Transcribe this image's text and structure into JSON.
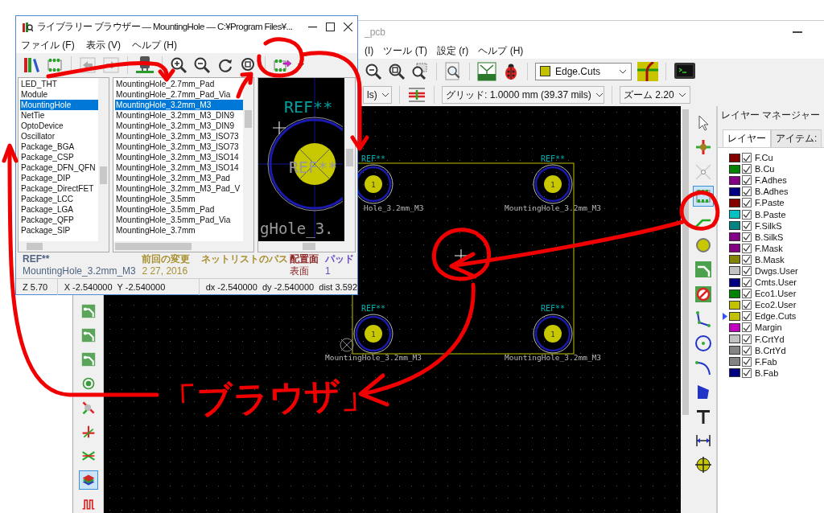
{
  "main_window": {
    "title_fragment": "_pcb",
    "menu": [
      "(I)",
      "ツール (T)",
      "設定 (r)",
      "ヘルプ (H)"
    ],
    "layer_select": "Edge.Cuts",
    "unit_fragment": "ls)",
    "grid": "グリッド: 1.0000 mm (39.37 mils)",
    "zoom": "ズーム 2.20",
    "left_tools": [
      {
        "kind": "bend",
        "selected": false
      },
      {
        "kind": "bend",
        "selected": false
      },
      {
        "kind": "bend",
        "selected": false
      },
      {
        "kind": "ring",
        "selected": false
      },
      {
        "kind": "probe",
        "selected": false
      },
      {
        "kind": "cross",
        "selected": false
      },
      {
        "kind": "crossing",
        "selected": false
      },
      {
        "kind": "layers",
        "selected": true
      },
      {
        "kind": "meander",
        "selected": false
      }
    ],
    "right_tools": [
      {
        "kind": "select",
        "selected": false
      },
      {
        "kind": "highlight",
        "selected": false
      },
      {
        "kind": "ratsnest",
        "selected": false
      },
      {
        "kind": "footprint",
        "selected": true
      },
      {
        "kind": "track",
        "selected": false
      },
      {
        "kind": "via",
        "selected": false
      },
      {
        "kind": "route",
        "selected": false
      },
      {
        "kind": "keepout",
        "selected": false
      },
      {
        "kind": "line",
        "selected": false
      },
      {
        "kind": "circle",
        "selected": false
      },
      {
        "kind": "arc",
        "selected": false
      },
      {
        "kind": "polygon",
        "selected": false
      },
      {
        "kind": "text",
        "selected": false
      },
      {
        "kind": "dimension",
        "selected": false
      },
      {
        "kind": "target",
        "selected": false
      }
    ],
    "canvas": {
      "holes": [
        {
          "ref": "REF**",
          "value": "Hole_3.2mm_M3",
          "pad": "1"
        },
        {
          "ref": "REF**",
          "value": "MountingHole_3.2mm_M3",
          "pad": "1"
        },
        {
          "ref": "REF**",
          "value": "MountingHole_3.2mm_M3",
          "pad": "1"
        },
        {
          "ref": "REF**",
          "value": "MountingHole_3.2mm_M3",
          "pad": "1"
        }
      ]
    },
    "layer_manager": {
      "title": "レイヤー マネージャー",
      "tabs": [
        {
          "label": "レイヤー",
          "selected": true
        },
        {
          "label": "アイテム:",
          "selected": false
        }
      ],
      "layers": [
        {
          "name": "F.Cu",
          "color": "#840000",
          "checked": true,
          "active": false
        },
        {
          "name": "B.Cu",
          "color": "#008400",
          "checked": true,
          "active": false
        },
        {
          "name": "F.Adhes",
          "color": "#840084",
          "checked": true,
          "active": false
        },
        {
          "name": "B.Adhes",
          "color": "#000084",
          "checked": true,
          "active": false
        },
        {
          "name": "F.Paste",
          "color": "#840000",
          "checked": true,
          "active": false
        },
        {
          "name": "B.Paste",
          "color": "#00c2c2",
          "checked": true,
          "active": false
        },
        {
          "name": "F.SilkS",
          "color": "#008484",
          "checked": true,
          "active": false
        },
        {
          "name": "B.SilkS",
          "color": "#840084",
          "checked": true,
          "active": false
        },
        {
          "name": "F.Mask",
          "color": "#840084",
          "checked": true,
          "active": false
        },
        {
          "name": "B.Mask",
          "color": "#848400",
          "checked": true,
          "active": false
        },
        {
          "name": "Dwgs.User",
          "color": "#c2c2c2",
          "checked": true,
          "active": false
        },
        {
          "name": "Cmts.User",
          "color": "#000084",
          "checked": true,
          "active": false
        },
        {
          "name": "Eco1.User",
          "color": "#008400",
          "checked": true,
          "active": false
        },
        {
          "name": "Eco2.User",
          "color": "#c2c200",
          "checked": true,
          "active": false
        },
        {
          "name": "Edge.Cuts",
          "color": "#c2c200",
          "checked": true,
          "active": true
        },
        {
          "name": "Margin",
          "color": "#c200c2",
          "checked": true,
          "active": false
        },
        {
          "name": "F.CrtYd",
          "color": "#c2c2c2",
          "checked": true,
          "active": false
        },
        {
          "name": "B.CrtYd",
          "color": "#848484",
          "checked": true,
          "active": false
        },
        {
          "name": "F.Fab",
          "color": "#848484",
          "checked": true,
          "active": false
        },
        {
          "name": "B.Fab",
          "color": "#000084",
          "checked": true,
          "active": false
        }
      ]
    }
  },
  "browser": {
    "title": "ライブラリー ブラウザー — MountingHole — C:¥Program Files¥...",
    "menu": [
      "ファイル (F)",
      "表示 (V)",
      "ヘルプ (H)"
    ],
    "libraries": [
      {
        "label": "LED_THT",
        "selected": false
      },
      {
        "label": "Module",
        "selected": false
      },
      {
        "label": "MountingHole",
        "selected": true
      },
      {
        "label": "NetTie",
        "selected": false
      },
      {
        "label": "OptoDevice",
        "selected": false
      },
      {
        "label": "Oscillator",
        "selected": false
      },
      {
        "label": "Package_BGA",
        "selected": false
      },
      {
        "label": "Package_CSP",
        "selected": false
      },
      {
        "label": "Package_DFN_QFN",
        "selected": false
      },
      {
        "label": "Package_DIP",
        "selected": false
      },
      {
        "label": "Package_DirectFET",
        "selected": false
      },
      {
        "label": "Package_LCC",
        "selected": false
      },
      {
        "label": "Package_LGA",
        "selected": false
      },
      {
        "label": "Package_QFP",
        "selected": false
      },
      {
        "label": "Package_SIP",
        "selected": false
      }
    ],
    "footprints": [
      {
        "label": "MountingHole_2.7mm_Pad",
        "selected": false
      },
      {
        "label": "MountingHole_2.7mm_Pad_Via",
        "selected": false
      },
      {
        "label": "MountingHole_3.2mm_M3",
        "selected": true
      },
      {
        "label": "MountingHole_3.2mm_M3_DIN9",
        "selected": false
      },
      {
        "label": "MountingHole_3.2mm_M3_DIN9",
        "selected": false
      },
      {
        "label": "MountingHole_3.2mm_M3_ISO73",
        "selected": false
      },
      {
        "label": "MountingHole_3.2mm_M3_ISO73",
        "selected": false
      },
      {
        "label": "MountingHole_3.2mm_M3_ISO14",
        "selected": false
      },
      {
        "label": "MountingHole_3.2mm_M3_ISO14",
        "selected": false
      },
      {
        "label": "MountingHole_3.2mm_M3_Pad",
        "selected": false
      },
      {
        "label": "MountingHole_3.2mm_M3_Pad_V",
        "selected": false
      },
      {
        "label": "MountingHole_3.5mm",
        "selected": false
      },
      {
        "label": "MountingHole_3.5mm_Pad",
        "selected": false
      },
      {
        "label": "MountingHole_3.5mm_Pad_Via",
        "selected": false
      },
      {
        "label": "MountingHole_3.7mm",
        "selected": false
      }
    ],
    "preview": {
      "ref_top": "REF**",
      "ref_center": "REF**",
      "value_fragment": "gHole_3."
    },
    "info": [
      {
        "title": "REF**",
        "value": "MountingHole_3.2mm_M3",
        "color": "#4f6482"
      },
      {
        "title": "前回の変更",
        "value": "2 27, 2016",
        "color": "#a89030"
      },
      {
        "title": "ネットリストのパス",
        "color": "#a89030"
      },
      {
        "title": "配置面",
        "value": "表面",
        "color": "#8c2323"
      },
      {
        "title": "パッド",
        "value": "1",
        "color": "#6a4cc0"
      }
    ],
    "status": [
      "Z 5.70",
      "X -2.540000  Y -2.540000",
      "dx -2.540000  dy -2.540000  dist 3.592"
    ]
  },
  "annotation": {
    "text": "「ブラウザ」"
  }
}
